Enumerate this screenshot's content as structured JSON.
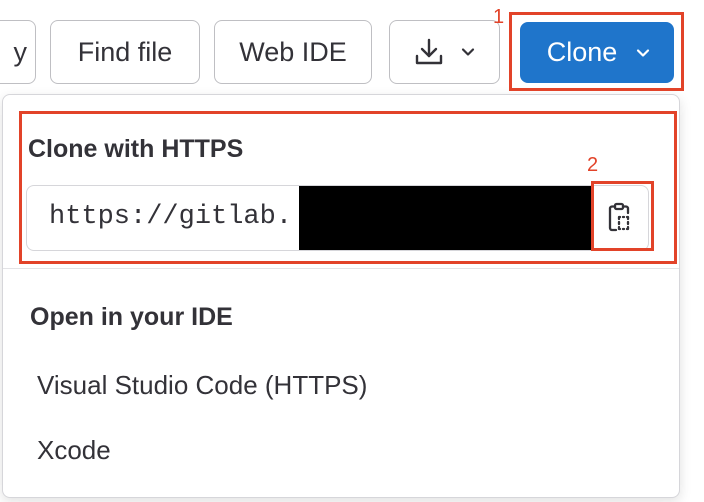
{
  "toolbar": {
    "cut_button_label": "y",
    "find_file_label": "Find file",
    "web_ide_label": "Web IDE",
    "download_icon": "download-icon",
    "clone_label": "Clone"
  },
  "annotations": {
    "marker_1": "1",
    "marker_2": "2",
    "color": "#e24329"
  },
  "clone_dropdown": {
    "https_section_title": "Clone with HTTPS",
    "https_url": "https://gitlab.",
    "url_redacted": true,
    "copy_icon": "clipboard-copy-icon",
    "ide_section_title": "Open in your IDE",
    "ide_options": [
      "Visual Studio Code (HTTPS)",
      "Xcode"
    ]
  },
  "colors": {
    "primary_button": "#1f75cb",
    "text": "#333238",
    "border": "#bfbfc3"
  }
}
